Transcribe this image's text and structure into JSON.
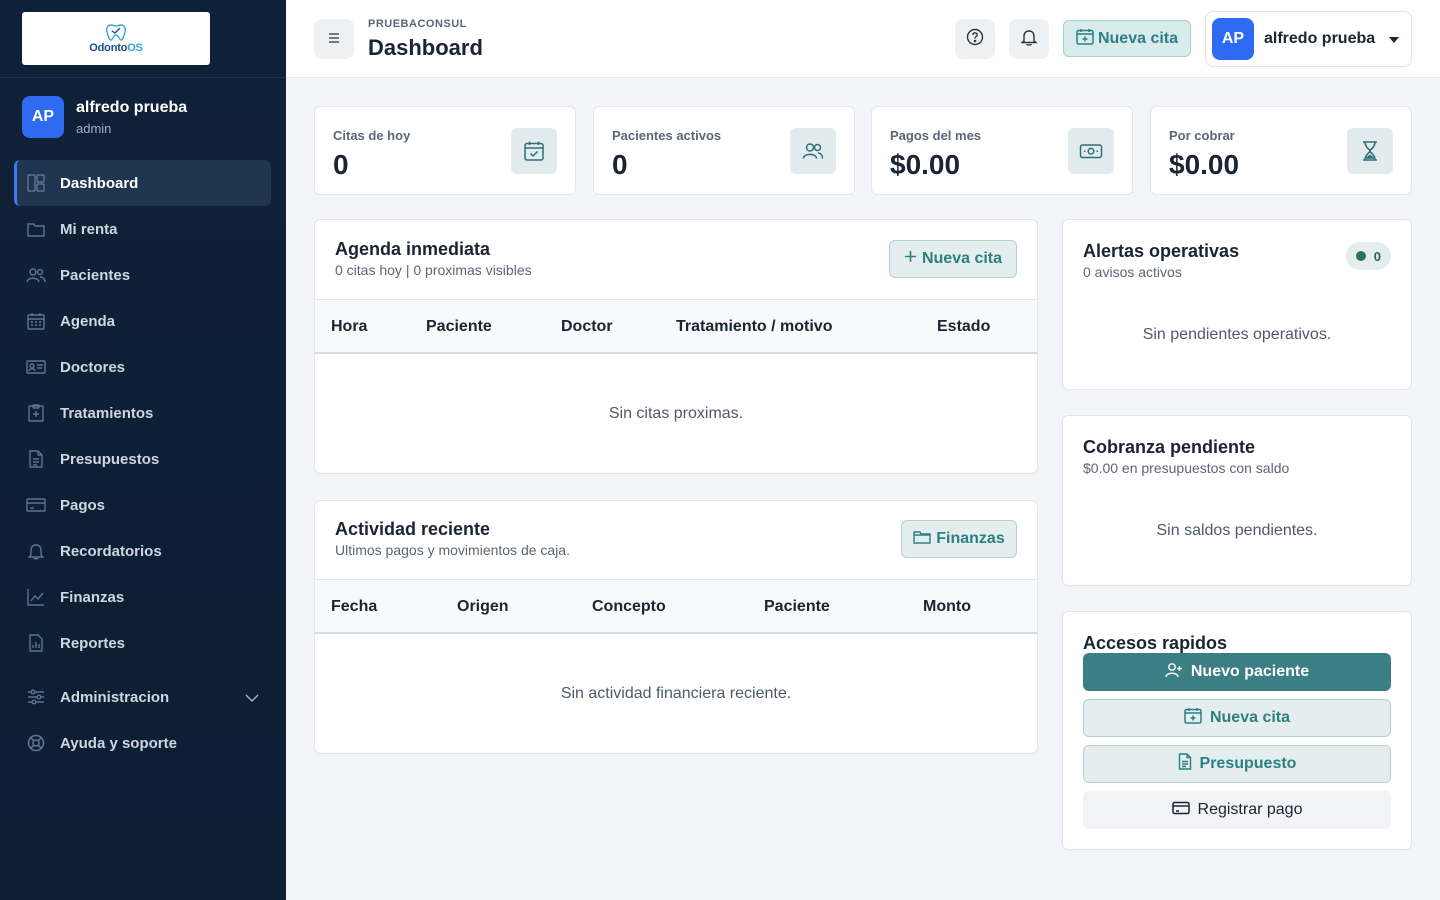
{
  "brand": {
    "logo_text_a": "Odonto",
    "logo_text_b": "OS"
  },
  "sidebar": {
    "user": {
      "initials": "AP",
      "name": "alfredo prueba",
      "role": "admin"
    },
    "items": [
      {
        "label": "Dashboard",
        "icon": "dashboard-icon"
      },
      {
        "label": "Mi renta",
        "icon": "folder-icon"
      },
      {
        "label": "Pacientes",
        "icon": "users-icon"
      },
      {
        "label": "Agenda",
        "icon": "calendar-icon"
      },
      {
        "label": "Doctores",
        "icon": "id-card-icon"
      },
      {
        "label": "Tratamientos",
        "icon": "medical-clipboard-icon"
      },
      {
        "label": "Presupuestos",
        "icon": "document-icon"
      },
      {
        "label": "Pagos",
        "icon": "credit-card-icon"
      },
      {
        "label": "Recordatorios",
        "icon": "bell-icon"
      },
      {
        "label": "Finanzas",
        "icon": "trend-chart-icon"
      },
      {
        "label": "Reportes",
        "icon": "report-icon"
      },
      {
        "label": "Administracion",
        "icon": "sliders-icon"
      },
      {
        "label": "Ayuda y soporte",
        "icon": "lifebuoy-icon"
      }
    ]
  },
  "header": {
    "org": "PRUEBACONSUL",
    "title": "Dashboard",
    "cta_label": "Nueva cita",
    "user_initials": "AP",
    "user_name": "alfredo prueba"
  },
  "stats": [
    {
      "label": "Citas de hoy",
      "value": "0"
    },
    {
      "label": "Pacientes activos",
      "value": "0"
    },
    {
      "label": "Pagos del mes",
      "value": "$0.00"
    },
    {
      "label": "Por cobrar",
      "value": "$0.00"
    }
  ],
  "agenda": {
    "title": "Agenda inmediata",
    "subtitle": "0 citas hoy | 0 proximas visibles",
    "button": "Nueva cita",
    "columns": [
      "Hora",
      "Paciente",
      "Doctor",
      "Tratamiento / motivo",
      "Estado"
    ],
    "empty": "Sin citas proximas."
  },
  "activity": {
    "title": "Actividad reciente",
    "subtitle": "Ultimos pagos y movimientos de caja.",
    "button": "Finanzas",
    "columns": [
      "Fecha",
      "Origen",
      "Concepto",
      "Paciente",
      "Monto"
    ],
    "empty": "Sin actividad financiera reciente."
  },
  "alerts": {
    "title": "Alertas operativas",
    "subtitle": "0 avisos activos",
    "badge": "0",
    "empty": "Sin pendientes operativos."
  },
  "billing": {
    "title": "Cobranza pendiente",
    "subtitle": "$0.00 en presupuestos con saldo",
    "empty": "Sin saldos pendientes."
  },
  "quick": {
    "title": "Accesos rapidos",
    "buttons": [
      "Nuevo paciente",
      "Nueva cita",
      "Presupuesto",
      "Registrar pago"
    ]
  },
  "colors": {
    "sidebar": "#0f2138",
    "accent": "#3b7e84",
    "avatar": "#2f6bf2"
  }
}
